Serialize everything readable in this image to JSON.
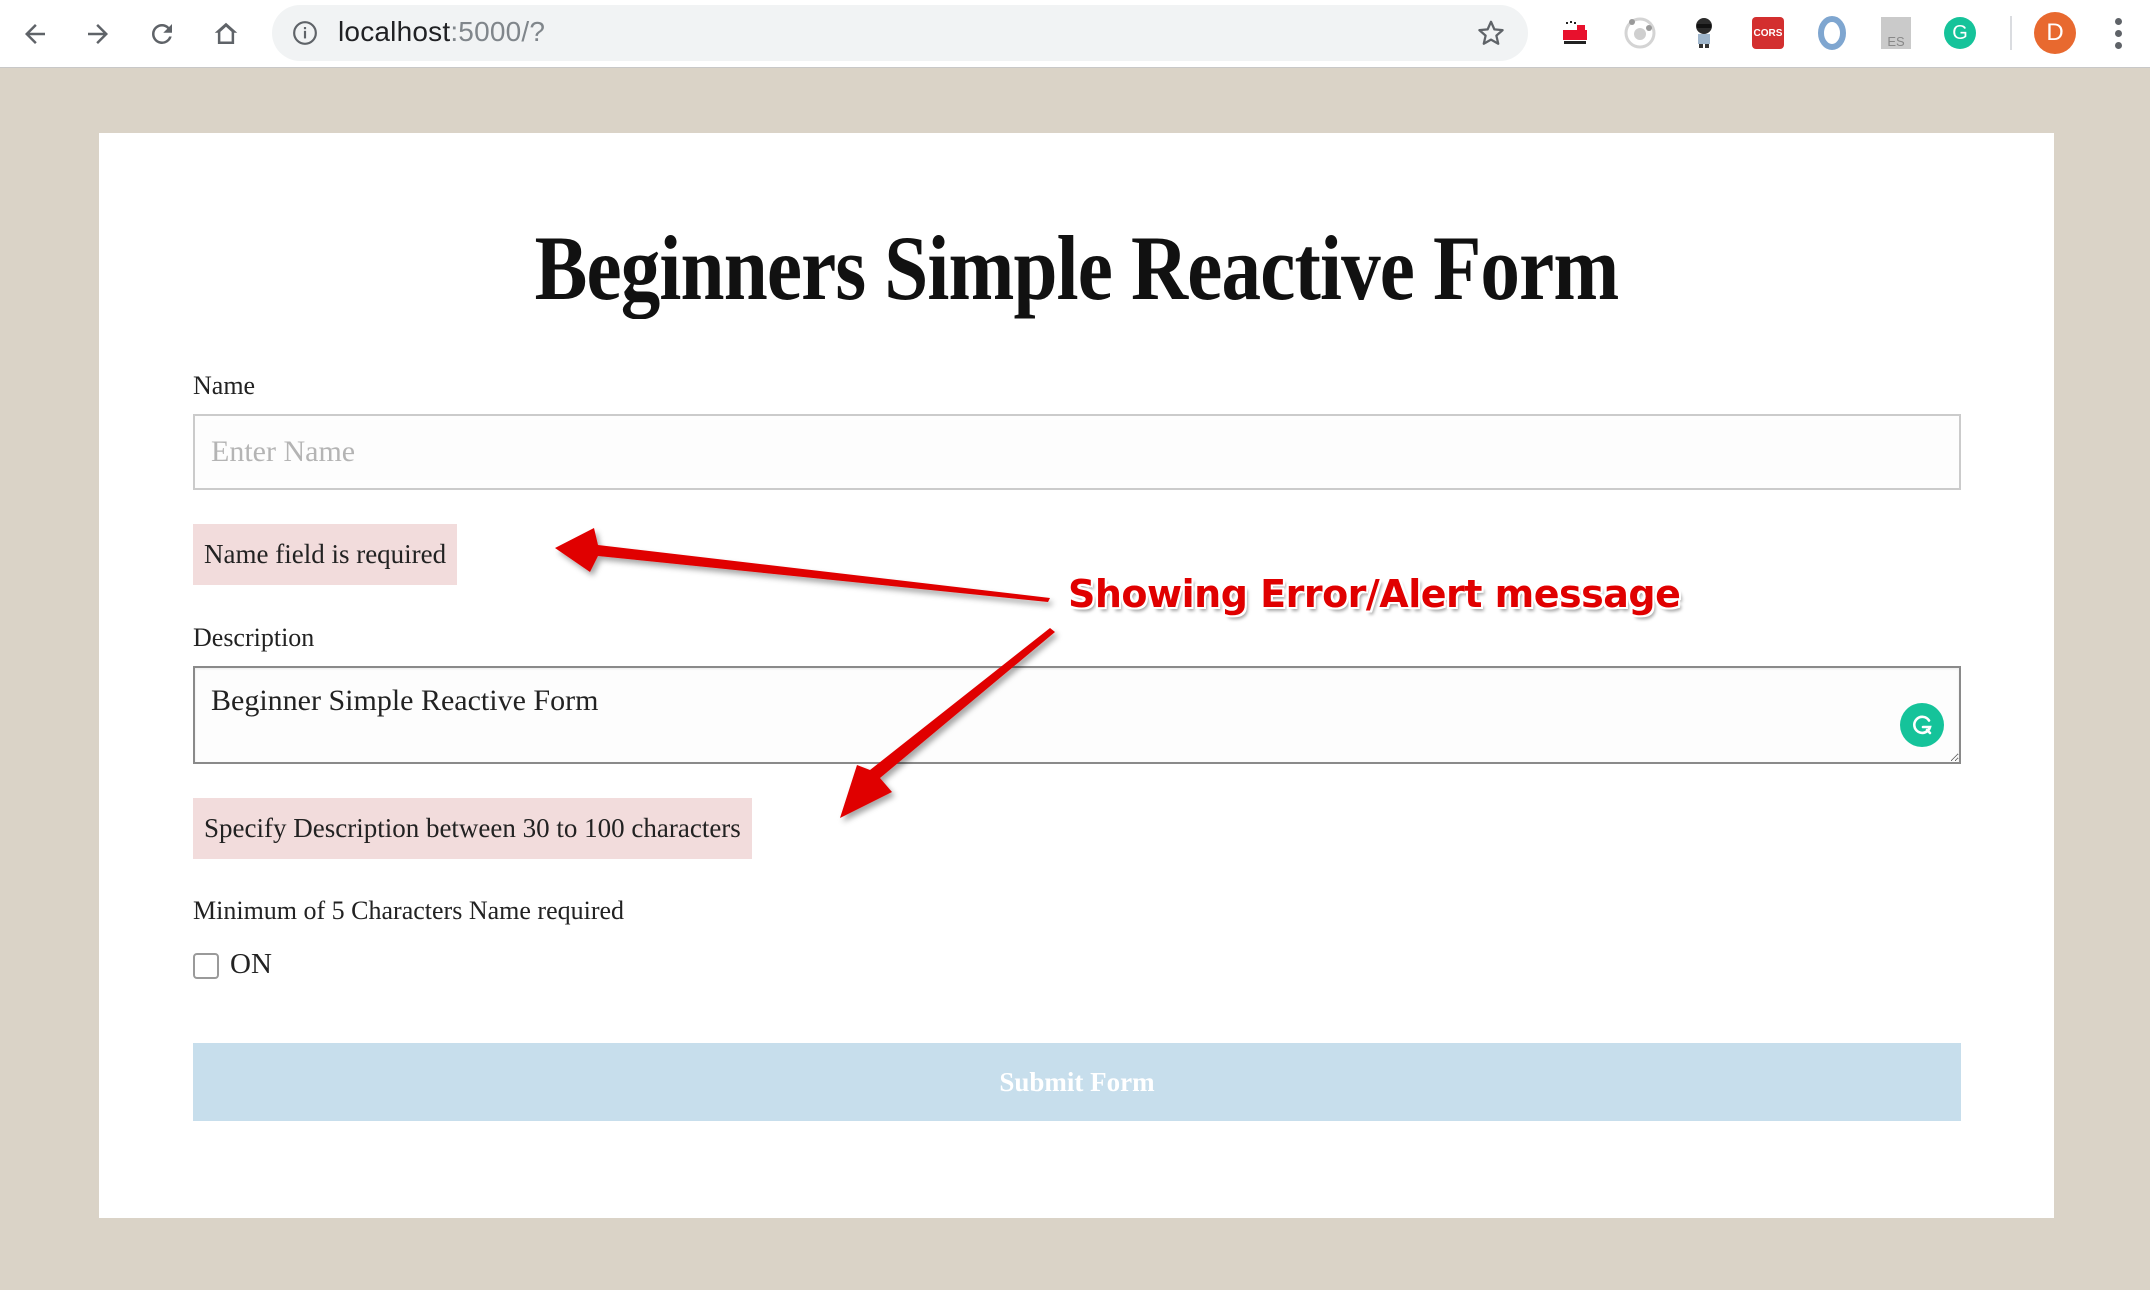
{
  "browser": {
    "url_host": "localhost",
    "url_rest": ":5000/?",
    "extensions": [
      {
        "name": "train-extension-icon"
      },
      {
        "name": "circle-extension-icon"
      },
      {
        "name": "octocat-extension-icon"
      },
      {
        "name": "cors-extension-icon",
        "label": "CORS"
      },
      {
        "name": "swirl-extension-icon"
      },
      {
        "name": "es-extension-icon",
        "label": "ES"
      },
      {
        "name": "grammarly-extension-icon",
        "label": "G"
      }
    ],
    "profile_initial": "D",
    "colors": {
      "profile": "#e8692f",
      "grammarly": "#15c39a",
      "cors": "#d32f2f"
    }
  },
  "form": {
    "title": "Beginners Simple Reactive Form",
    "name_label": "Name",
    "name_placeholder": "Enter Name",
    "name_value": "",
    "name_error": "Name field is required",
    "description_label": "Description",
    "description_value": "Beginner Simple Reactive Form",
    "description_error": "Specify Description between 30 to 100 characters",
    "min_chars_label": "Minimum of 5 Characters Name required",
    "checkbox_label": "ON",
    "checkbox_checked": false,
    "submit_label": "Submit Form",
    "submit_disabled": true
  },
  "annotation": {
    "text": "Showing Error/Alert message",
    "color": "#e00000"
  },
  "colors": {
    "page_background": "#dad3c7",
    "error_background": "#f2dcdc",
    "submit_background": "#c7deec"
  }
}
